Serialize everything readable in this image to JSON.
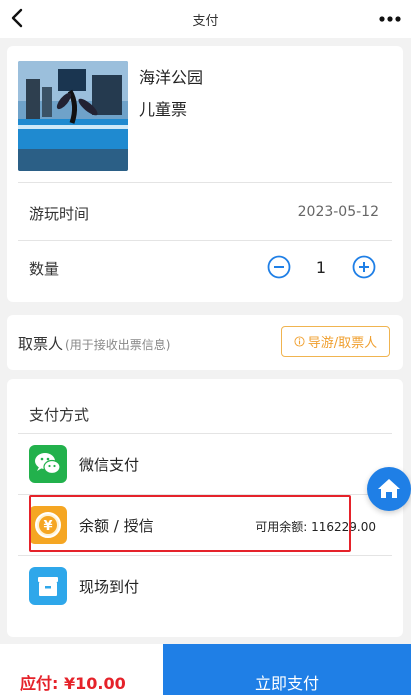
{
  "header": {
    "title": "支付",
    "back_icon": "back-chevron-icon",
    "more_icon": "more-dots-icon"
  },
  "product": {
    "name": "海洋公园",
    "ticket_type": "儿童票",
    "play_time_label": "游玩时间",
    "play_date": "2023-05-12",
    "quantity_label": "数量",
    "quantity": "1"
  },
  "collector": {
    "label": "取票人",
    "hint": "(用于接收出票信息)",
    "guide_button": "导游/取票人"
  },
  "payment": {
    "title": "支付方式",
    "methods": [
      {
        "label": "微信支付",
        "icon": "wechat-icon"
      },
      {
        "label": "余额 / 授信",
        "icon": "yen-coin-icon",
        "balance_label": "可用余额:",
        "balance": "116229.00",
        "selected": true
      },
      {
        "label": "现场到付",
        "icon": "onsite-pay-icon"
      }
    ]
  },
  "footer": {
    "total": "应付: ¥10.00",
    "pay_button": "立即支付"
  },
  "colors": {
    "accent": "#1f7fe6",
    "price_red": "#e5222a",
    "guide_orange": "#f0a030",
    "wechat_green": "#22b14c"
  }
}
